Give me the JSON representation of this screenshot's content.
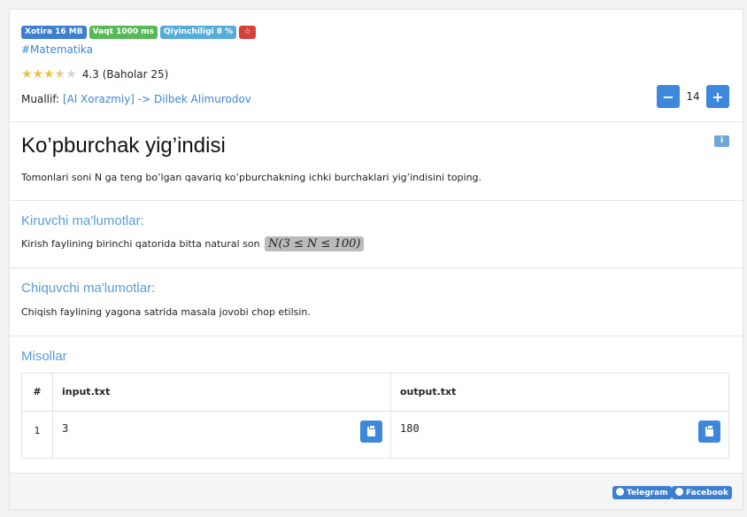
{
  "badges": {
    "memory": "Xotira 16 MB",
    "time": "Vaqt 1000 ms",
    "difficulty": "Qiyinchiligi 8 %",
    "star_button": "☆"
  },
  "tag": "#Matematika",
  "rating": {
    "stars_value": 4.3,
    "value": "4.3",
    "count_text": "(Baholar 25)"
  },
  "author": {
    "label": "Muallif:",
    "link_text": "[Al Xorazmiy] -> Dilbek Alimurodov"
  },
  "stepper": {
    "minus": "−",
    "value": "14",
    "plus": "+"
  },
  "problem": {
    "title": "Ko’pburchak yig’indisi",
    "info_icon": "i",
    "description": "Tomonlari soni N ga teng bo’lgan qavariq ko’pburchakning ichki burchaklari yig’indisini toping."
  },
  "input_section": {
    "heading": "Kiruvchi ma'lumotlar:",
    "text": "Kirish faylining birinchi qatorida bitta natural son",
    "math": "N(3 ≤ N ≤ 100)"
  },
  "output_section": {
    "heading": "Chiquvchi ma'lumotlar:",
    "text": "Chiqish faylining yagona satrida masala jovobi chop etilsin."
  },
  "examples": {
    "heading": "Misollar",
    "columns": [
      "#",
      "input.txt",
      "output.txt"
    ],
    "rows": [
      {
        "num": "1",
        "input": "3",
        "output": "180"
      }
    ]
  },
  "share": {
    "telegram": "Telegram",
    "facebook": "Facebook"
  },
  "colors": {
    "primary": "#3d88dc",
    "heading_blue": "#5a9bd9",
    "badge_green": "#58b858",
    "badge_red": "#d6403b"
  }
}
